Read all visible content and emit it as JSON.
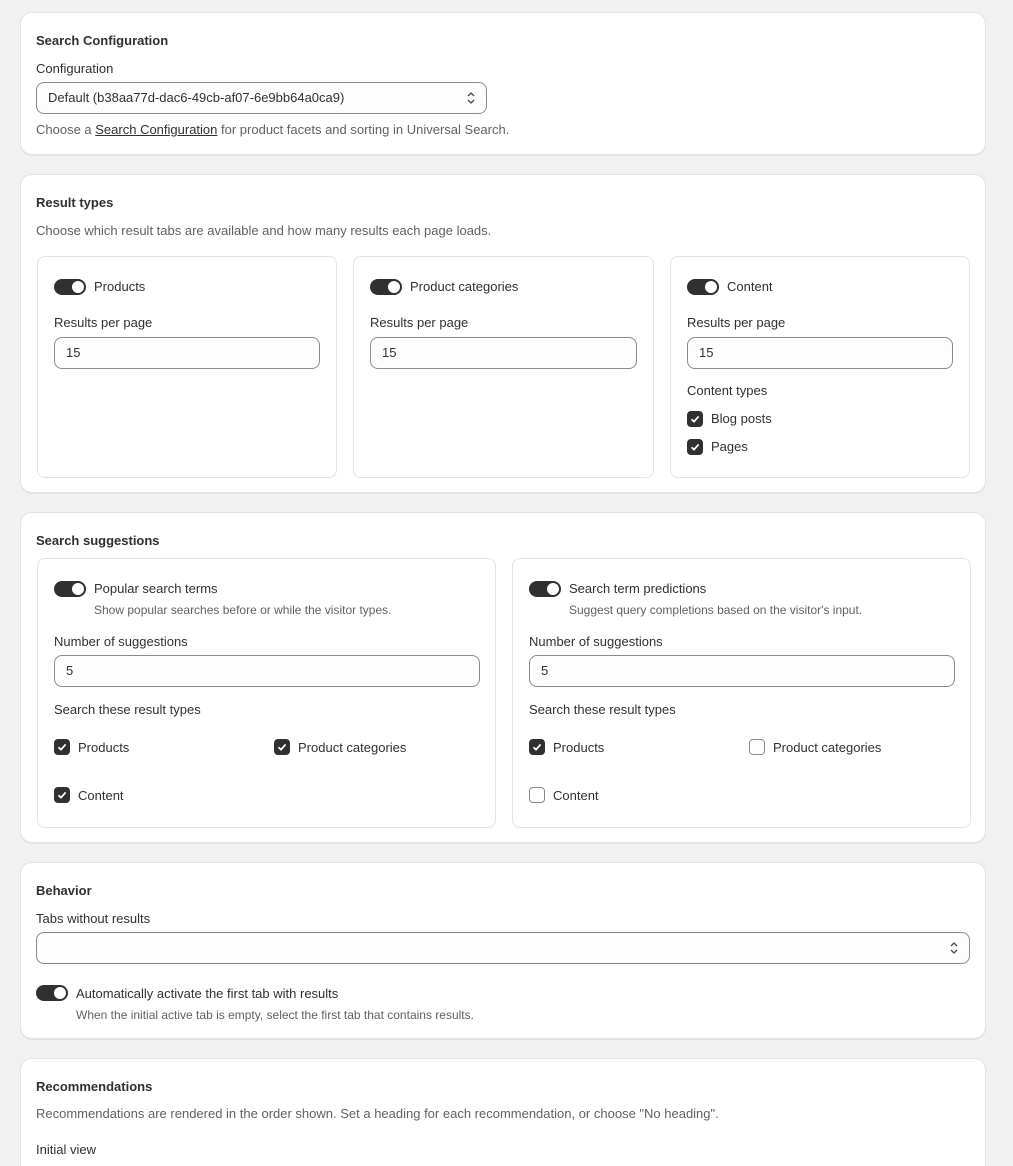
{
  "search_configuration": {
    "heading": "Search Configuration",
    "field_label": "Configuration",
    "selected_value": "Default (b38aa77d-dac6-49cb-af07-6e9bb64a0ca9)",
    "help_prefix": "Choose a ",
    "help_link": "Search Configuration",
    "help_suffix": " for product facets and sorting in Universal Search."
  },
  "result_types": {
    "heading": "Result types",
    "description": "Choose which result tabs are available and how many results each page loads.",
    "panels": [
      {
        "toggle_label": "Products",
        "toggle_on": true,
        "rpp_label": "Results per page",
        "rpp_value": "15"
      },
      {
        "toggle_label": "Product categories",
        "toggle_on": true,
        "rpp_label": "Results per page",
        "rpp_value": "15"
      },
      {
        "toggle_label": "Content",
        "toggle_on": true,
        "rpp_label": "Results per page",
        "rpp_value": "15",
        "content_types_label": "Content types",
        "content_types": [
          {
            "label": "Blog posts",
            "checked": true
          },
          {
            "label": "Pages",
            "checked": true
          }
        ]
      }
    ]
  },
  "search_suggestions": {
    "heading": "Search suggestions",
    "panels": [
      {
        "toggle_label": "Popular search terms",
        "toggle_on": true,
        "description": "Show popular searches before or while the visitor types.",
        "count_label": "Number of suggestions",
        "count_value": "5",
        "types_label": "Search these result types",
        "types": [
          {
            "label": "Products",
            "checked": true
          },
          {
            "label": "Product categories",
            "checked": true
          },
          {
            "label": "Content",
            "checked": true
          }
        ]
      },
      {
        "toggle_label": "Search term predictions",
        "toggle_on": true,
        "description": "Suggest query completions based on the visitor's input.",
        "count_label": "Number of suggestions",
        "count_value": "5",
        "types_label": "Search these result types",
        "types": [
          {
            "label": "Products",
            "checked": true
          },
          {
            "label": "Product categories",
            "checked": false
          },
          {
            "label": "Content",
            "checked": false
          }
        ]
      }
    ]
  },
  "behavior": {
    "heading": "Behavior",
    "tabs_label": "Tabs without results",
    "tabs_value": "",
    "auto_toggle_label": "Automatically activate the first tab with results",
    "auto_toggle_on": true,
    "auto_toggle_help": "When the initial active tab is empty, select the first tab that contains results."
  },
  "recommendations": {
    "heading": "Recommendations",
    "description": "Recommendations are rendered in the order shown. Set a heading for each recommendation, or choose \"No heading\".",
    "initial_view_label": "Initial view"
  },
  "colors": {
    "page_bg": "#f1f1f1",
    "card_bg": "#ffffff",
    "toggle_on": "#303030",
    "checkbox_on": "#303030",
    "text": "#303030",
    "subdued_text": "#616161"
  }
}
